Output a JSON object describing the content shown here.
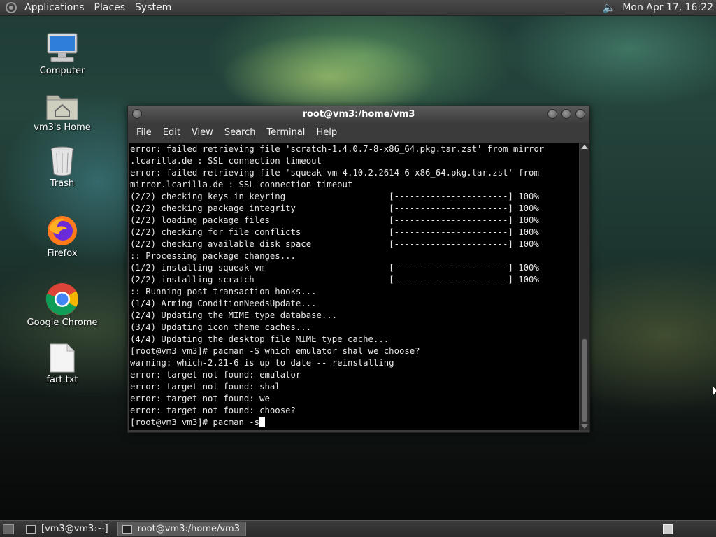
{
  "top_panel": {
    "menus": [
      "Applications",
      "Places",
      "System"
    ],
    "clock": "Mon Apr 17, 16:22",
    "volume_icon": "speaker-icon"
  },
  "desktop_icons": [
    {
      "label": "Computer",
      "icon": "computer-icon"
    },
    {
      "label": "vm3's Home",
      "icon": "home-folder-icon"
    },
    {
      "label": "Trash",
      "icon": "trash-icon"
    },
    {
      "label": "Firefox",
      "icon": "firefox-icon"
    },
    {
      "label": "Google Chrome",
      "icon": "chrome-icon"
    },
    {
      "label": "fart.txt",
      "icon": "text-file-icon"
    }
  ],
  "window": {
    "title": "root@vm3:/home/vm3",
    "menus": [
      "File",
      "Edit",
      "View",
      "Search",
      "Terminal",
      "Help"
    ],
    "terminal_lines": [
      "error: failed retrieving file 'scratch-1.4.0.7-8-x86_64.pkg.tar.zst' from mirror",
      ".lcarilla.de : SSL connection timeout",
      "error: failed retrieving file 'squeak-vm-4.10.2.2614-6-x86_64.pkg.tar.zst' from",
      "mirror.lcarilla.de : SSL connection timeout",
      "(2/2) checking keys in keyring                    [----------------------] 100%",
      "(2/2) checking package integrity                  [----------------------] 100%",
      "(2/2) loading package files                       [----------------------] 100%",
      "(2/2) checking for file conflicts                 [----------------------] 100%",
      "(2/2) checking available disk space               [----------------------] 100%",
      ":: Processing package changes...",
      "(1/2) installing squeak-vm                        [----------------------] 100%",
      "(2/2) installing scratch                          [----------------------] 100%",
      ":: Running post-transaction hooks...",
      "(1/4) Arming ConditionNeedsUpdate...",
      "(2/4) Updating the MIME type database...",
      "(3/4) Updating icon theme caches...",
      "(4/4) Updating the desktop file MIME type cache...",
      "[root@vm3 vm3]# pacman -S which emulator shal we choose?",
      "warning: which-2.21-6 is up to date -- reinstalling",
      "error: target not found: emulator",
      "error: target not found: shal",
      "error: target not found: we",
      "error: target not found: choose?"
    ],
    "prompt_line": "[root@vm3 vm3]# pacman -s"
  },
  "bottom_panel": {
    "tasks": [
      {
        "label": "[vm3@vm3:~]",
        "active": false
      },
      {
        "label": "root@vm3:/home/vm3",
        "active": true
      }
    ]
  }
}
